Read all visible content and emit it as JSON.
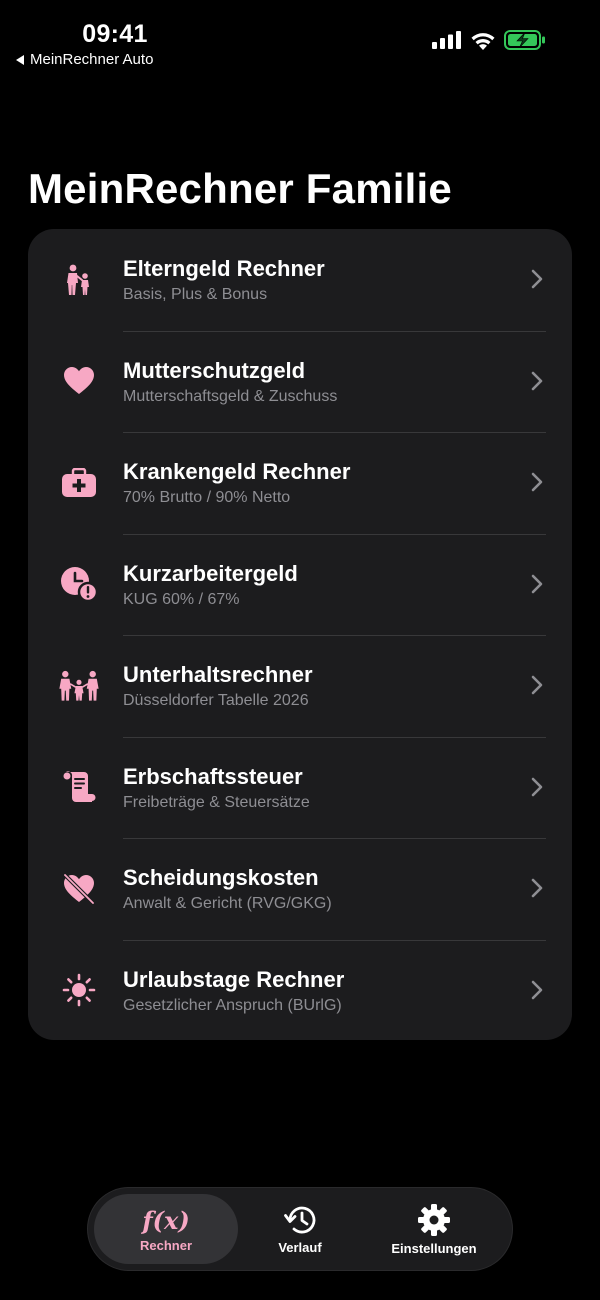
{
  "status": {
    "time": "09:41",
    "back_label": "MeinRechner Auto"
  },
  "page": {
    "title": "MeinRechner Familie"
  },
  "colors": {
    "accent": "#f7a8c4",
    "card_bg": "#1c1c1e",
    "battery_green": "#34c759"
  },
  "items": [
    {
      "title": "Elterngeld Rechner",
      "subtitle": "Basis, Plus & Bonus",
      "icon": "parent-child-icon"
    },
    {
      "title": "Mutterschutzgeld",
      "subtitle": "Mutterschaftsgeld & Zuschuss",
      "icon": "heart-icon"
    },
    {
      "title": "Krankengeld Rechner",
      "subtitle": "70% Brutto / 90% Netto",
      "icon": "medical-kit-icon"
    },
    {
      "title": "Kurzarbeitergeld",
      "subtitle": "KUG 60% / 67%",
      "icon": "clock-alert-icon"
    },
    {
      "title": "Unterhaltsrechner",
      "subtitle": "Düsseldorfer Tabelle 2026",
      "icon": "family-icon"
    },
    {
      "title": "Erbschaftssteuer",
      "subtitle": "Freibeträge & Steuersätze",
      "icon": "scroll-icon"
    },
    {
      "title": "Scheidungskosten",
      "subtitle": "Anwalt & Gericht (RVG/GKG)",
      "icon": "heart-slash-icon"
    },
    {
      "title": "Urlaubstage Rechner",
      "subtitle": "Gesetzlicher Anspruch (BUrlG)",
      "icon": "sun-icon"
    }
  ],
  "tabs": [
    {
      "label": "Rechner",
      "icon_text": "f(x)",
      "active": true
    },
    {
      "label": "Verlauf",
      "active": false
    },
    {
      "label": "Einstellungen",
      "active": false
    }
  ]
}
